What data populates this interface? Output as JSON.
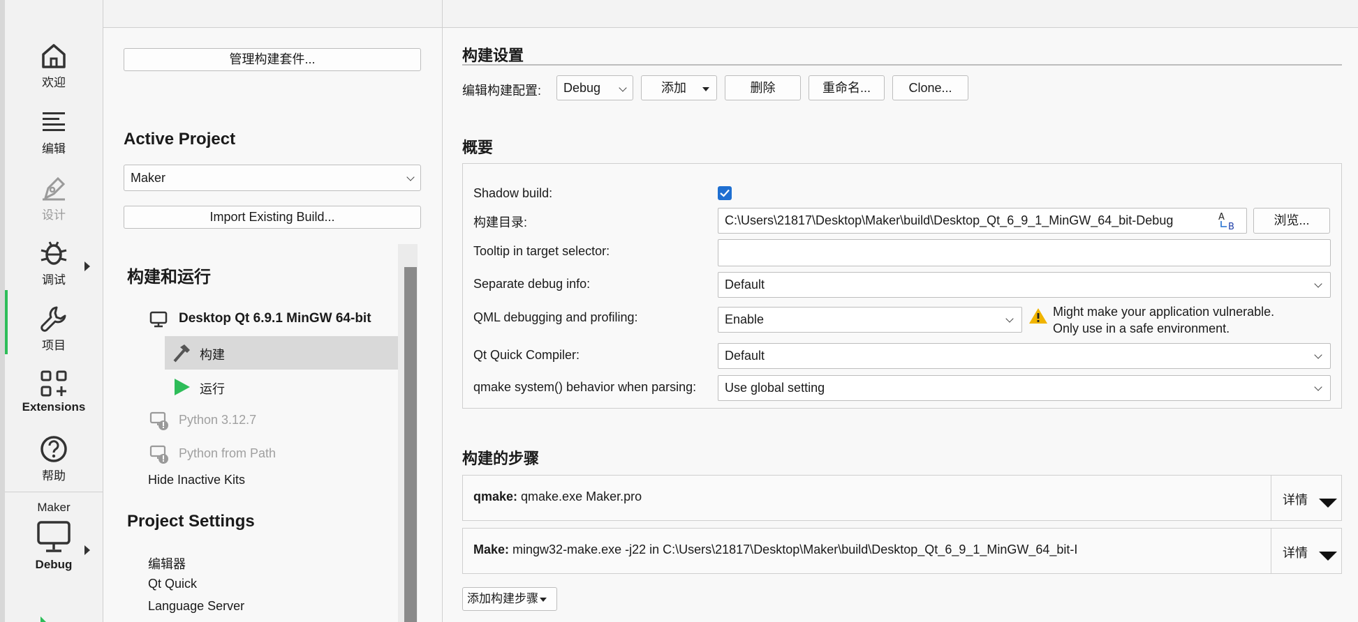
{
  "modebar": {
    "items": [
      {
        "label": "欢迎",
        "icon": "home-icon"
      },
      {
        "label": "编辑",
        "icon": "edit-lines-icon"
      },
      {
        "label": "设计",
        "icon": "pen-icon"
      },
      {
        "label": "调试",
        "icon": "bug-icon"
      },
      {
        "label": "项目",
        "icon": "wrench-icon"
      },
      {
        "label": "Extensions",
        "icon": "extensions-icon"
      },
      {
        "label": "帮助",
        "icon": "help-icon"
      }
    ],
    "active_project": "Maker",
    "build_config": "Debug",
    "accent_color": "#2ebd59"
  },
  "left": {
    "manage_kits_button": "管理构建套件...",
    "active_project_heading": "Active Project",
    "project_combo": "Maker",
    "import_build_button": "Import Existing Build...",
    "build_run_heading": "构建和运行",
    "kit_name": "Desktop Qt 6.9.1 MinGW 64-bit",
    "build_item": "构建",
    "run_item": "运行",
    "inactive_kits": [
      "Python 3.12.7",
      "Python from Path"
    ],
    "hide_inactive": "Hide Inactive Kits",
    "project_settings_heading": "Project Settings",
    "settings_items": [
      "编辑器",
      "Qt Quick",
      "Language Server"
    ]
  },
  "right": {
    "build_settings_title": "构建设置",
    "edit_config_label": "编辑构建配置:",
    "config_combo": "Debug",
    "add_button": "添加",
    "delete_button": "删除",
    "rename_button": "重命名...",
    "clone_button": "Clone...",
    "overview_title": "概要",
    "shadow_build_label": "Shadow build:",
    "shadow_build_checked": true,
    "build_dir_label": "构建目录:",
    "build_dir_value": "C:\\Users\\21817\\Desktop\\Maker\\build\\Desktop_Qt_6_9_1_MinGW_64_bit-Debug",
    "browse_button": "浏览...",
    "tooltip_label": "Tooltip in target selector:",
    "tooltip_value": "",
    "sep_debug_label": "Separate debug info:",
    "sep_debug_value": "Default",
    "qml_debug_label": "QML debugging and profiling:",
    "qml_debug_value": "Enable",
    "qml_warning_line1": "Might make your application vulnerable.",
    "qml_warning_line2": "Only use in a safe environment.",
    "qtquick_label": "Qt Quick Compiler:",
    "qtquick_value": "Default",
    "qmake_label": "qmake system() behavior when parsing:",
    "qmake_value": "Use global setting",
    "build_steps_title": "构建的步骤",
    "steps": [
      {
        "name": "qmake:",
        "detail": " qmake.exe Maker.pro",
        "details_button": "详情"
      },
      {
        "name": "Make:",
        "detail": " mingw32-make.exe -j22 in C:\\Users\\21817\\Desktop\\Maker\\build\\Desktop_Qt_6_9_1_MinGW_64_bit-I",
        "details_button": "详情"
      }
    ],
    "add_step_button": "添加构建步骤"
  }
}
